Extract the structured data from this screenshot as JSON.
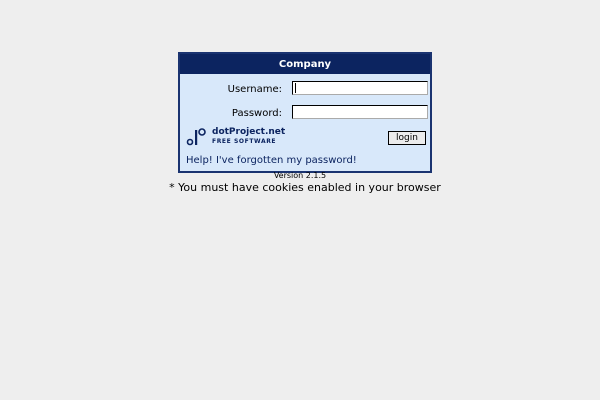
{
  "login": {
    "title": "Company",
    "username_label": "Username:",
    "username_value": "",
    "password_label": "Password:",
    "password_value": "",
    "login_button": "login",
    "forgot_link": "Help! I've forgotten my password!"
  },
  "logo": {
    "name": "dotProject.net",
    "subtitle": "FREE SOFTWARE",
    "icon": "dotproject-logo-icon"
  },
  "footer": {
    "version": "Version 2.1.5",
    "cookie_note": "* You must have cookies enabled in your browser"
  },
  "colors": {
    "header_bg": "#0c2460",
    "box_bg": "#d8e8fa",
    "page_bg": "#eeeeee"
  }
}
